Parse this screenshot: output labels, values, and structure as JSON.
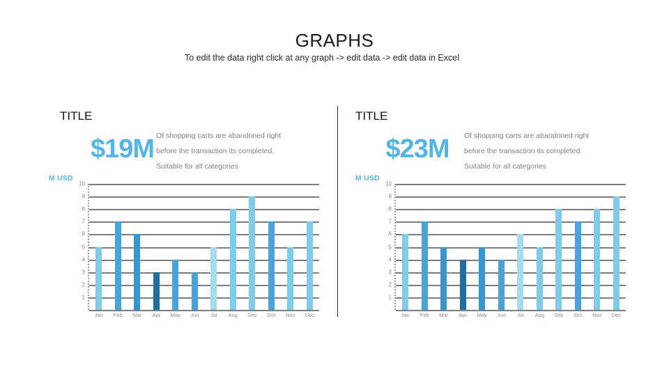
{
  "header": {
    "title": "GRAPHS",
    "subtitle": "To edit the data right click at any graph -> edit data -> edit data in Excel"
  },
  "colors": {
    "accent": "#54b4e4",
    "light_blue": "#7fcbea",
    "mid_blue": "#4aa3d8",
    "dark_blue": "#1f6f9e",
    "grid": "#7d7d7d",
    "body_text": "#808080",
    "divider": "#2a2a2a"
  },
  "panels": [
    {
      "title": "TITLE",
      "big_number": "$19M",
      "blurb_line1": "Of shopping carts are abandoned right",
      "blurb_line2": "before the transaction its completed.",
      "blurb_line3": "Suitable for all categories",
      "unit_label": "M USD",
      "chart_data": {
        "type": "bar",
        "title": "TITLE",
        "xlabel": "",
        "ylabel": "M USD",
        "ylim": [
          0,
          10
        ],
        "yticks": [
          "10",
          "9",
          "8",
          "7",
          "6",
          "5",
          "4",
          "3",
          "2",
          "1",
          "0"
        ],
        "grid": true,
        "legend": "none",
        "categories": [
          "Jan",
          "Feb",
          "Mar",
          "Apr",
          "May",
          "Jun",
          "Jul",
          "Aug",
          "Sep",
          "Oct",
          "Nov",
          "Dec"
        ],
        "values": [
          5,
          7,
          6,
          3,
          4,
          3,
          5,
          8,
          9,
          7,
          5,
          7
        ],
        "bar_colors": [
          "#7fcbea",
          "#4aa3d8",
          "#3894cf",
          "#1f6f9e",
          "#4aa3d8",
          "#4aa3d8",
          "#a3dbf0",
          "#7fcbea",
          "#7fcbea",
          "#4aa3d8",
          "#7fcbea",
          "#7fcbea"
        ]
      }
    },
    {
      "title": "TITLE",
      "big_number": "$23M",
      "blurb_line1": "Of shopping carts are abandoned right",
      "blurb_line2": "before the transaction its completed.",
      "blurb_line3": "Suitable for all categories",
      "unit_label": "M USD",
      "chart_data": {
        "type": "bar",
        "title": "TITLE",
        "xlabel": "",
        "ylabel": "M USD",
        "ylim": [
          0,
          10
        ],
        "yticks": [
          "10",
          "9",
          "8",
          "7",
          "6",
          "5",
          "4",
          "3",
          "2",
          "1",
          "0"
        ],
        "grid": true,
        "legend": "none",
        "categories": [
          "Jan",
          "Feb",
          "Mar",
          "Apr",
          "May",
          "Jun",
          "Jul",
          "Aug",
          "Sep",
          "Oct",
          "Nov",
          "Dec"
        ],
        "values": [
          6,
          7,
          5,
          4,
          5,
          4,
          6,
          5,
          8,
          7,
          8,
          9
        ],
        "bar_colors": [
          "#7fcbea",
          "#4aa3d8",
          "#3894cf",
          "#1f6f9e",
          "#3894cf",
          "#4aa3d8",
          "#a3dbf0",
          "#7fcbea",
          "#7fcbea",
          "#4aa3d8",
          "#7fcbea",
          "#7fcbea"
        ]
      }
    }
  ]
}
